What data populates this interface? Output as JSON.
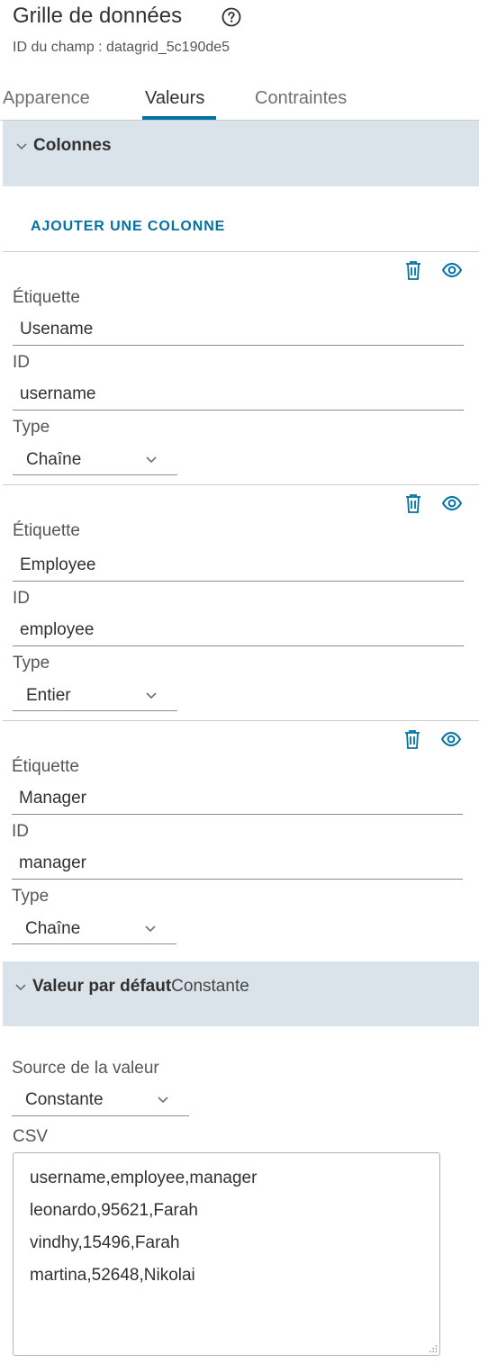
{
  "header": {
    "title": "Grille de données",
    "field_id": "ID du champ : datagrid_5c190de5"
  },
  "tabs": [
    {
      "label": "Apparence"
    },
    {
      "label": "Valeurs"
    },
    {
      "label": "Contraintes"
    }
  ],
  "colonnes": {
    "title": "Colonnes",
    "add_label": "AJOUTER UNE COLONNE",
    "columns": [
      {
        "label_caption": "Étiquette",
        "label_value": "Usename",
        "id_caption": "ID",
        "id_value": "username",
        "type_caption": "Type",
        "type_value": "Chaîne"
      },
      {
        "label_caption": "Étiquette",
        "label_value": "Employee",
        "id_caption": "ID",
        "id_value": "employee",
        "type_caption": "Type",
        "type_value": "Entier"
      },
      {
        "label_caption": "Étiquette",
        "label_value": "Manager",
        "id_caption": "ID",
        "id_value": "manager",
        "type_caption": "Type",
        "type_value": "Chaîne"
      }
    ]
  },
  "default_value": {
    "title": "Valeur par défaut",
    "subtitle": "Constante",
    "source_caption": "Source de la valeur",
    "source_value": "Constante",
    "csv_caption": "CSV",
    "csv_lines": [
      "username,employee,manager",
      "leonardo,95621,Farah",
      "vindhy,15496,Farah",
      "martina,52648,Nikolai"
    ]
  },
  "colors": {
    "accent": "#0072a3",
    "section_bg": "#dae3ea"
  },
  "icons": [
    "help-icon",
    "chevron-down-icon",
    "trash-icon",
    "eye-icon",
    "resize-handle-icon"
  ]
}
